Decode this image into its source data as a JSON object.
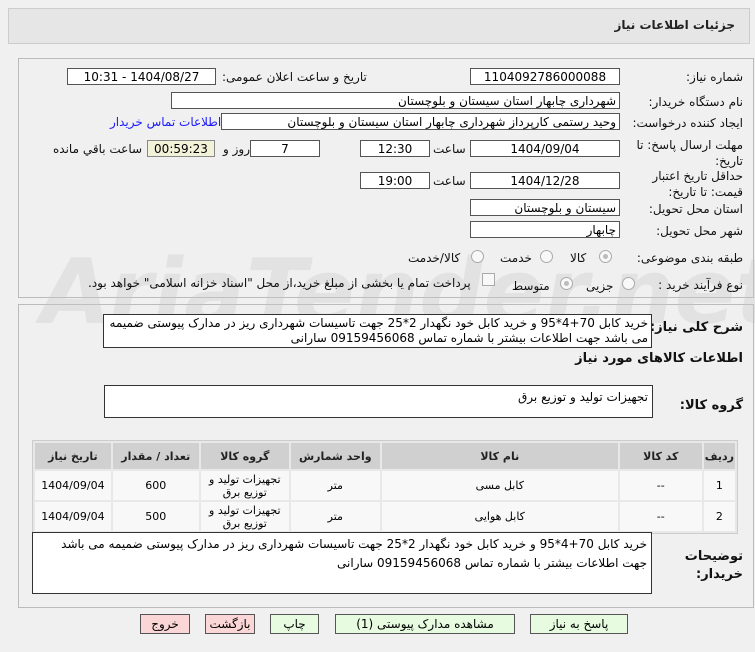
{
  "title": "جزئیات اطلاعات نیاز",
  "fields": {
    "need_number_label": "شماره نیاز:",
    "need_number": "1104092786000088",
    "announce_label": "تاریخ و ساعت اعلان عمومی:",
    "announce": "1404/08/27 - 10:31",
    "buyer_label": "نام دستگاه خریدار:",
    "buyer": "شهرداری چابهار استان سیستان و بلوچستان",
    "creator_label": "ایجاد کننده درخواست:",
    "creator": "وحید رستمی کارپرداز شهرداری چابهار استان سیستان و بلوچستان",
    "contact_link": "اطلاعات تماس خریدار",
    "deadline_label": "مهلت ارسال پاسخ: تا تاریخ:",
    "deadline_date": "1404/09/04",
    "hour_label": "ساعت",
    "deadline_time": "12:30",
    "days": "7",
    "days_label": "روز و",
    "remaining": "00:59:23",
    "remaining_label": "ساعت باقي مانده",
    "validity_label": "حداقل تاریخ اعتبار قیمت: تا تاریخ:",
    "validity_date": "1404/12/28",
    "validity_time": "19:00",
    "province_label": "استان محل تحویل:",
    "province": "سیستان و بلوچستان",
    "city_label": "شهر محل تحویل:",
    "city": "چابهار",
    "category_label": "طبقه بندی موضوعی:",
    "cat_options": [
      "کالا",
      "خدمت",
      "کالا/خدمت"
    ],
    "process_label": "نوع فرآیند خرید :",
    "process_options": [
      "جزیی",
      "متوسط"
    ],
    "payment_note": "پرداخت تمام یا بخشی از مبلغ خرید،از محل \"اسناد خزانه اسلامی\" خواهد بود."
  },
  "description_label": "شرح کلی نیاز:",
  "description": "خرید کابل 70+4*95 و خرید کابل خود نگهدار 2*25 جهت تاسیسات شهرداری ریز در مدارک پیوستی ضمیمه می باشد جهت اطلاعات بیشتر با شماره تماس 09159456068 سارانی",
  "goods_header": "اطلاعات کالاهای مورد نیاز",
  "goods_group_label": "گروه کالا:",
  "goods_group": "تجهیزات تولید و توزیع برق",
  "table": {
    "headers": [
      "ردیف",
      "کد کالا",
      "نام کالا",
      "واحد شمارش",
      "گروه کالا",
      "تعداد / مقدار",
      "تاریخ نیاز"
    ],
    "rows": [
      [
        "1",
        "--",
        "کابل مسی",
        "متر",
        "تجهیزات تولید و توزیع برق",
        "600",
        "1404/09/04"
      ],
      [
        "2",
        "--",
        "کابل هوایی",
        "متر",
        "تجهیزات تولید و توزیع برق",
        "500",
        "1404/09/04"
      ]
    ]
  },
  "notes_label": "توضیحات خریدار:",
  "notes": "خرید کابل 70+4*95 و خرید کابل خود نگهدار 2*25 جهت تاسیسات شهرداری ریز در مدارک پیوستی ضمیمه می باشد جهت اطلاعات بیشتر با شماره تماس 09159456068 سارانی",
  "buttons": {
    "reply": "پاسخ به نیاز",
    "attachments": "مشاهده مدارک پیوستی (1)",
    "print": "چاپ",
    "back": "بازگشت",
    "exit": "خروج"
  }
}
